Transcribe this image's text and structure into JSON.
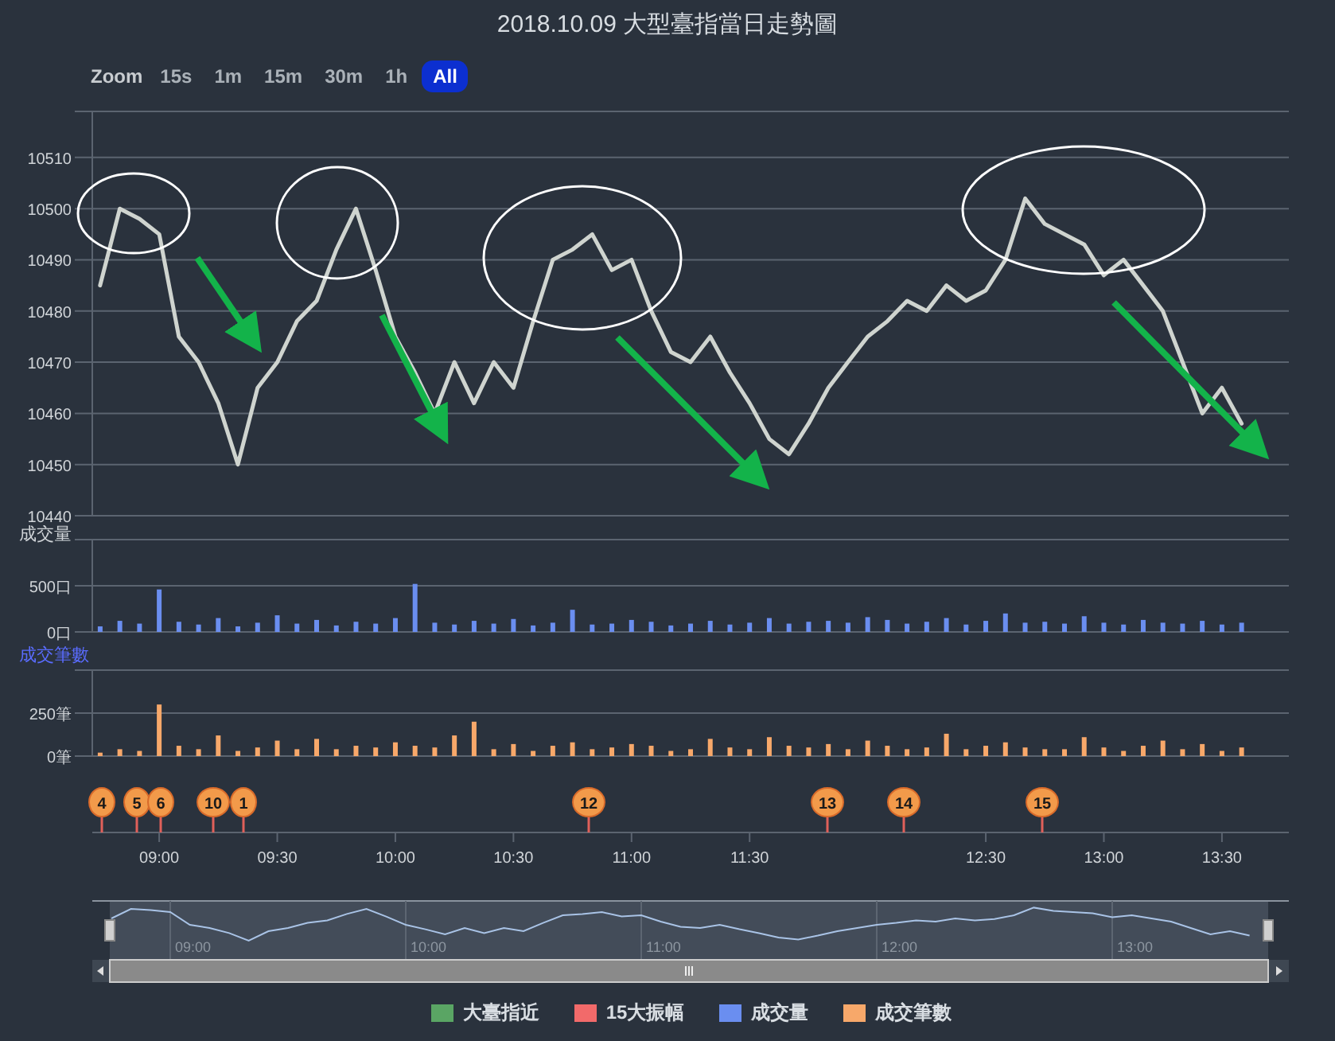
{
  "title": "2018.10.09 大型臺指當日走勢圖",
  "range_selector": {
    "label": "Zoom",
    "buttons": [
      {
        "label": "15s",
        "selected": false
      },
      {
        "label": "1m",
        "selected": false
      },
      {
        "label": "15m",
        "selected": false
      },
      {
        "label": "30m",
        "selected": false
      },
      {
        "label": "1h",
        "selected": false
      },
      {
        "label": "All",
        "selected": true
      }
    ]
  },
  "price_chart": {
    "chart_data": {
      "type": "line",
      "grid": true,
      "ylim": [
        10440,
        10519
      ],
      "yticks": [
        10440,
        10450,
        10460,
        10470,
        10480,
        10490,
        10500,
        10510
      ],
      "series": [
        {
          "color": "#cfd4cf",
          "values": [
            10485,
            10500,
            10498,
            10495,
            10475,
            10470,
            10462,
            10450,
            10465,
            10470,
            10478,
            10482,
            10492,
            10500,
            10488,
            10475,
            10468,
            10460,
            10470,
            10462,
            10470,
            10465,
            10478,
            10490,
            10492,
            10495,
            10488,
            10490,
            10480,
            10472,
            10470,
            10475,
            10468,
            10462,
            10455,
            10452,
            10458,
            10465,
            10470,
            10475,
            10478,
            10482,
            10480,
            10485,
            10482,
            10484,
            10490,
            10502,
            10497,
            10495,
            10493,
            10487,
            10490,
            10485,
            10480,
            10470,
            10460,
            10465,
            10458
          ]
        }
      ]
    }
  },
  "volume_chart": {
    "label": "成交量",
    "chart_data": {
      "type": "bar",
      "grid": true,
      "ylim": [
        0,
        1000
      ],
      "yticks": [
        {
          "value": 0,
          "label": "0口"
        },
        {
          "value": 500,
          "label": "500口"
        }
      ],
      "series": [
        {
          "color": "#6a8ef0",
          "values": [
            60,
            120,
            90,
            460,
            110,
            80,
            150,
            60,
            100,
            180,
            90,
            130,
            70,
            110,
            90,
            150,
            520,
            100,
            80,
            120,
            90,
            140,
            70,
            100,
            240,
            80,
            90,
            130,
            110,
            70,
            90,
            120,
            80,
            100,
            150,
            90,
            110,
            120,
            100,
            160,
            130,
            90,
            110,
            150,
            80,
            120,
            200,
            100,
            110,
            90,
            170,
            100,
            80,
            130,
            100,
            90,
            120,
            80,
            100
          ]
        }
      ]
    }
  },
  "orders_chart": {
    "label": "成交筆數",
    "chart_data": {
      "type": "bar",
      "grid": true,
      "ylim": [
        0,
        500
      ],
      "yticks": [
        {
          "value": 0,
          "label": "0筆"
        },
        {
          "value": 250,
          "label": "250筆"
        }
      ],
      "series": [
        {
          "color": "#f7a86a",
          "values": [
            20,
            40,
            30,
            300,
            60,
            40,
            120,
            30,
            50,
            90,
            40,
            100,
            40,
            60,
            50,
            80,
            60,
            50,
            120,
            200,
            40,
            70,
            30,
            60,
            80,
            40,
            50,
            70,
            60,
            30,
            40,
            100,
            50,
            40,
            110,
            60,
            50,
            70,
            40,
            90,
            60,
            40,
            50,
            130,
            40,
            60,
            80,
            50,
            40,
            40,
            110,
            50,
            30,
            60,
            90,
            40,
            70,
            30,
            50
          ]
        }
      ]
    }
  },
  "time_axis": [
    "09:00",
    "09:30",
    "10:00",
    "10:30",
    "11:00",
    "11:30",
    "12:30",
    "13:00",
    "13:30"
  ],
  "flags": [
    {
      "label": "4"
    },
    {
      "label": "5"
    },
    {
      "label": "6"
    },
    {
      "label": "10"
    },
    {
      "label": "1"
    },
    {
      "label": "12"
    },
    {
      "label": "13"
    },
    {
      "label": "14"
    },
    {
      "label": "15"
    }
  ],
  "navigator": {
    "labels": [
      "09:00",
      "10:00",
      "11:00",
      "12:00",
      "13:00"
    ]
  },
  "legend": [
    {
      "name": "大臺指近",
      "color": "#5aa564"
    },
    {
      "name": "15大振幅",
      "color": "#f26a6a"
    },
    {
      "name": "成交量",
      "color": "#6a8ef0"
    },
    {
      "name": "成交筆數",
      "color": "#f7a86a"
    }
  ]
}
